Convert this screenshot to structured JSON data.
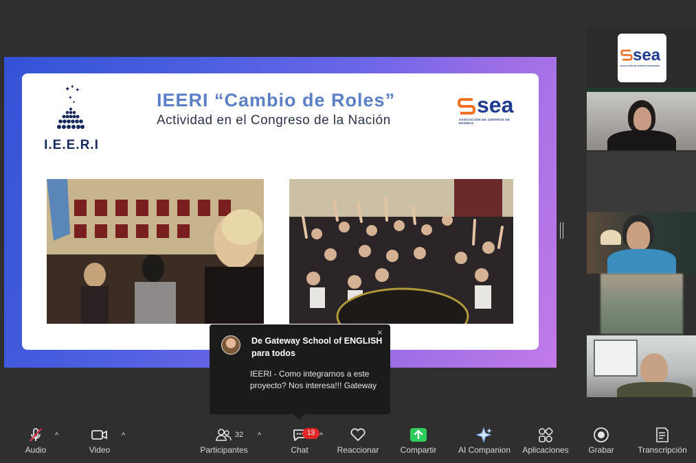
{
  "slide": {
    "title": "IEERI “Cambio de Roles”",
    "subtitle": "Actividad en el Congreso de la Nación",
    "org_logo_text": "I.E.E.R.I",
    "sea_logo_word": "sea",
    "sea_logo_tagline": "ASOCIACIÓN DE CENTROS DE IDIOMAS"
  },
  "participants": {
    "logo_tile_word": "sea",
    "logo_tile_tagline": "ASOCIACIÓN DE CENTROS DE IDIOMAS"
  },
  "chat_popup": {
    "from": "De Gateway School of ENGLISH para todos",
    "message": "IEERI - Como integrarnos a este proyecto? Nos interesa!!! Gateway",
    "close": "×"
  },
  "toolbar": {
    "audio": "Audio",
    "video": "Video",
    "participants": "Participantes",
    "participants_count": "32",
    "chat": "Chat",
    "chat_badge": "13",
    "react": "Reaccionar",
    "share": "Compartir",
    "ai": "AI Companion",
    "apps": "Aplicaciones",
    "record": "Grabar",
    "transcript": "Transcripción",
    "caret": "^"
  },
  "colors": {
    "share_green": "#2ecc5a",
    "badge_red": "#e02828",
    "mute_red": "#e0394b"
  }
}
